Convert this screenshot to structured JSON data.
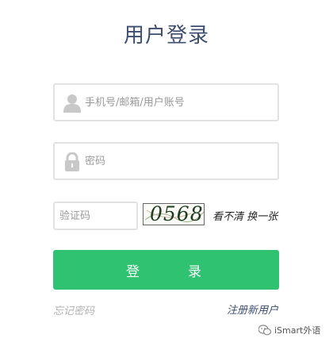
{
  "title": "用户登录",
  "username": {
    "placeholder": "手机号/邮箱/用户账号",
    "icon": "user-icon"
  },
  "password": {
    "placeholder": "密码",
    "icon": "lock-icon"
  },
  "captcha": {
    "placeholder": "验证码",
    "code": "0568",
    "refresh_label": "看不清 换一张"
  },
  "login_button": "登　录",
  "forgot_label": "忘记密码",
  "register_label": "注册新用户",
  "watermark": "iSmart外语",
  "colors": {
    "title": "#3c4d6e",
    "button": "#2ec271",
    "link": "#3c4d6e",
    "muted": "#b3b3b3"
  }
}
